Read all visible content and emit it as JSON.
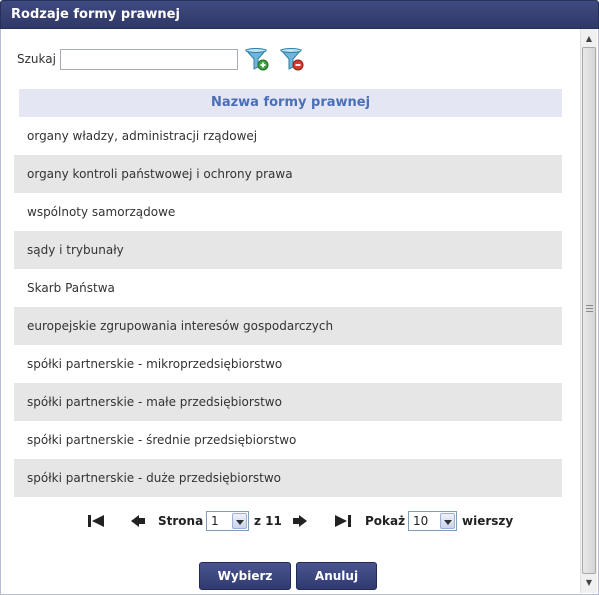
{
  "window": {
    "title": "Rodzaje formy prawnej"
  },
  "search": {
    "label": "Szukaj",
    "value": "",
    "placeholder": "",
    "add_filter_icon": "filter-add-icon",
    "remove_filter_icon": "filter-remove-icon"
  },
  "table": {
    "header": "Nazwa formy prawnej",
    "rows": [
      "organy władzy, administracji rządowej",
      "organy kontroli państwowej i ochrony prawa",
      "wspólnoty samorządowe",
      "sądy i trybunały",
      "Skarb Państwa",
      "europejskie zgrupowania interesów gospodarczych",
      "spółki partnerskie - mikroprzedsiębiorstwo",
      "spółki partnerskie - małe przedsiębiorstwo",
      "spółki partnerskie - średnie przedsiębiorstwo",
      "spółki partnerskie - duże przedsiębiorstwo"
    ]
  },
  "pager": {
    "page_label": "Strona",
    "current_page": "1",
    "of_label": "z 11",
    "show_label": "Pokaż",
    "rows_per_page": "10",
    "rows_label": "wierszy"
  },
  "buttons": {
    "select": "Wybierz",
    "cancel": "Anuluj"
  },
  "colors": {
    "titlebar": "#2f3868",
    "header_bg": "#e4e6f4",
    "header_text": "#4a6fb4",
    "row_alt": "#e6e6e6",
    "button_bg": "#2f3a70"
  }
}
